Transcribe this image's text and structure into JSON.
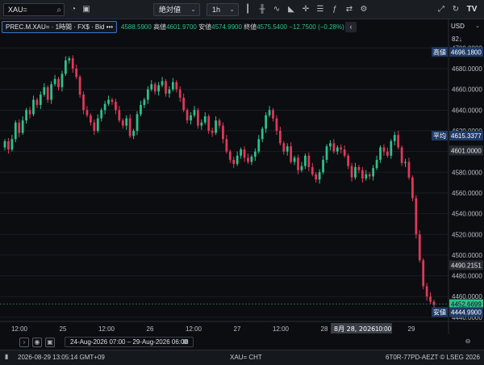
{
  "toolbar": {
    "search_value": "XAU=",
    "chart_style": "絶対値",
    "interval": "1h",
    "icon_names": [
      "search-icon",
      "clock-icon",
      "window-icon",
      "candle-icon",
      "ohlc-icon",
      "line-icon",
      "area-icon",
      "crosshair-icon",
      "menu-icon",
      "indicator-icon",
      "compare-icon",
      "settings-icon",
      "expand-icon",
      "refresh-icon",
      "tradingview-logo"
    ]
  },
  "legend": {
    "instrument": "PREC.M.XAU= · 1時間 · FX$ · Bid",
    "dots": "•••",
    "open_value": "4588.5900",
    "high_label": "高値",
    "high_value": "4601.9700",
    "low_label": "安値",
    "low_value": "4574.9900",
    "close_label": "終値",
    "close_value": "4575.5400",
    "change": "−12.7500 (−0.28%)",
    "collapse_icon": "‹"
  },
  "axis_header": {
    "currency": "USD",
    "scale": "82↓"
  },
  "footer": {
    "date_range": "24-Aug-2026 07:00 – 29-Aug-2026 06:00",
    "timestamp": "2026-08-29  13:05:14 GMT+09",
    "symbol": "XAU= CHT",
    "source": "6T0R-77PD-AEZT  © LSEG 2026"
  },
  "chart_data": {
    "type": "candlestick",
    "ylim": [
      4436,
      4712
    ],
    "y_ticks": [
      "4700.0000",
      "4680.0000",
      "4660.0000",
      "4640.0000",
      "4620.0000",
      "4600.0000",
      "4580.0000",
      "4560.0000",
      "4540.0000",
      "4520.0000",
      "4500.0000",
      "4480.0000",
      "4460.0000",
      "4440.0000"
    ],
    "x_ticks": [
      "12:00",
      "25",
      "12:00",
      "26",
      "12:00",
      "27",
      "12:00",
      "28",
      "12:00",
      "29"
    ],
    "price_labels": [
      {
        "text": "高値",
        "value": "4696.1800",
        "price": 4696.18,
        "kind": "marker"
      },
      {
        "text": "平均",
        "value": "4615.3377",
        "price": 4615.34,
        "kind": "marker"
      },
      {
        "text": "",
        "value": "4601.0000",
        "price": 4601.0,
        "kind": "plain"
      },
      {
        "text": "",
        "value": "4490.2151",
        "price": 4490.22,
        "kind": "plain"
      },
      {
        "text": "",
        "value": "4452.6699",
        "price": 4452.67,
        "kind": "current"
      },
      {
        "text": "安値",
        "value": "4444.9900",
        "price": 4444.99,
        "kind": "marker"
      }
    ],
    "crosshair_label": "8月 28, 2026",
    "crosshair_time": "10:00",
    "up_color": "#2fc08a",
    "down_color": "#e0385a",
    "closes": [
      4610,
      4602,
      4612,
      4628,
      4618,
      4630,
      4640,
      4636,
      4650,
      4645,
      4655,
      4662,
      4650,
      4665,
      4670,
      4662,
      4675,
      4688,
      4690,
      4680,
      4672,
      4655,
      4640,
      4635,
      4628,
      4620,
      4632,
      4640,
      4646,
      4650,
      4648,
      4640,
      4630,
      4625,
      4632,
      4615,
      4620,
      4636,
      4645,
      4650,
      4660,
      4665,
      4658,
      4664,
      4668,
      4656,
      4660,
      4667,
      4660,
      4652,
      4640,
      4630,
      4635,
      4640,
      4625,
      4628,
      4634,
      4620,
      4618,
      4630,
      4625,
      4612,
      4600,
      4592,
      4588,
      4596,
      4602,
      4594,
      4590,
      4595,
      4600,
      4612,
      4622,
      4635,
      4640,
      4632,
      4620,
      4608,
      4600,
      4605,
      4590,
      4594,
      4582,
      4586,
      4596,
      4585,
      4578,
      4573,
      4580,
      4592,
      4605,
      4608,
      4600,
      4604,
      4602,
      4596,
      4586,
      4575,
      4585,
      4582,
      4574,
      4578,
      4576,
      4584,
      4592,
      4604,
      4600,
      4596,
      4610,
      4616,
      4604,
      4589,
      4590,
      4575,
      4555,
      4520,
      4495,
      4470,
      4460,
      4455,
      4452
    ]
  }
}
